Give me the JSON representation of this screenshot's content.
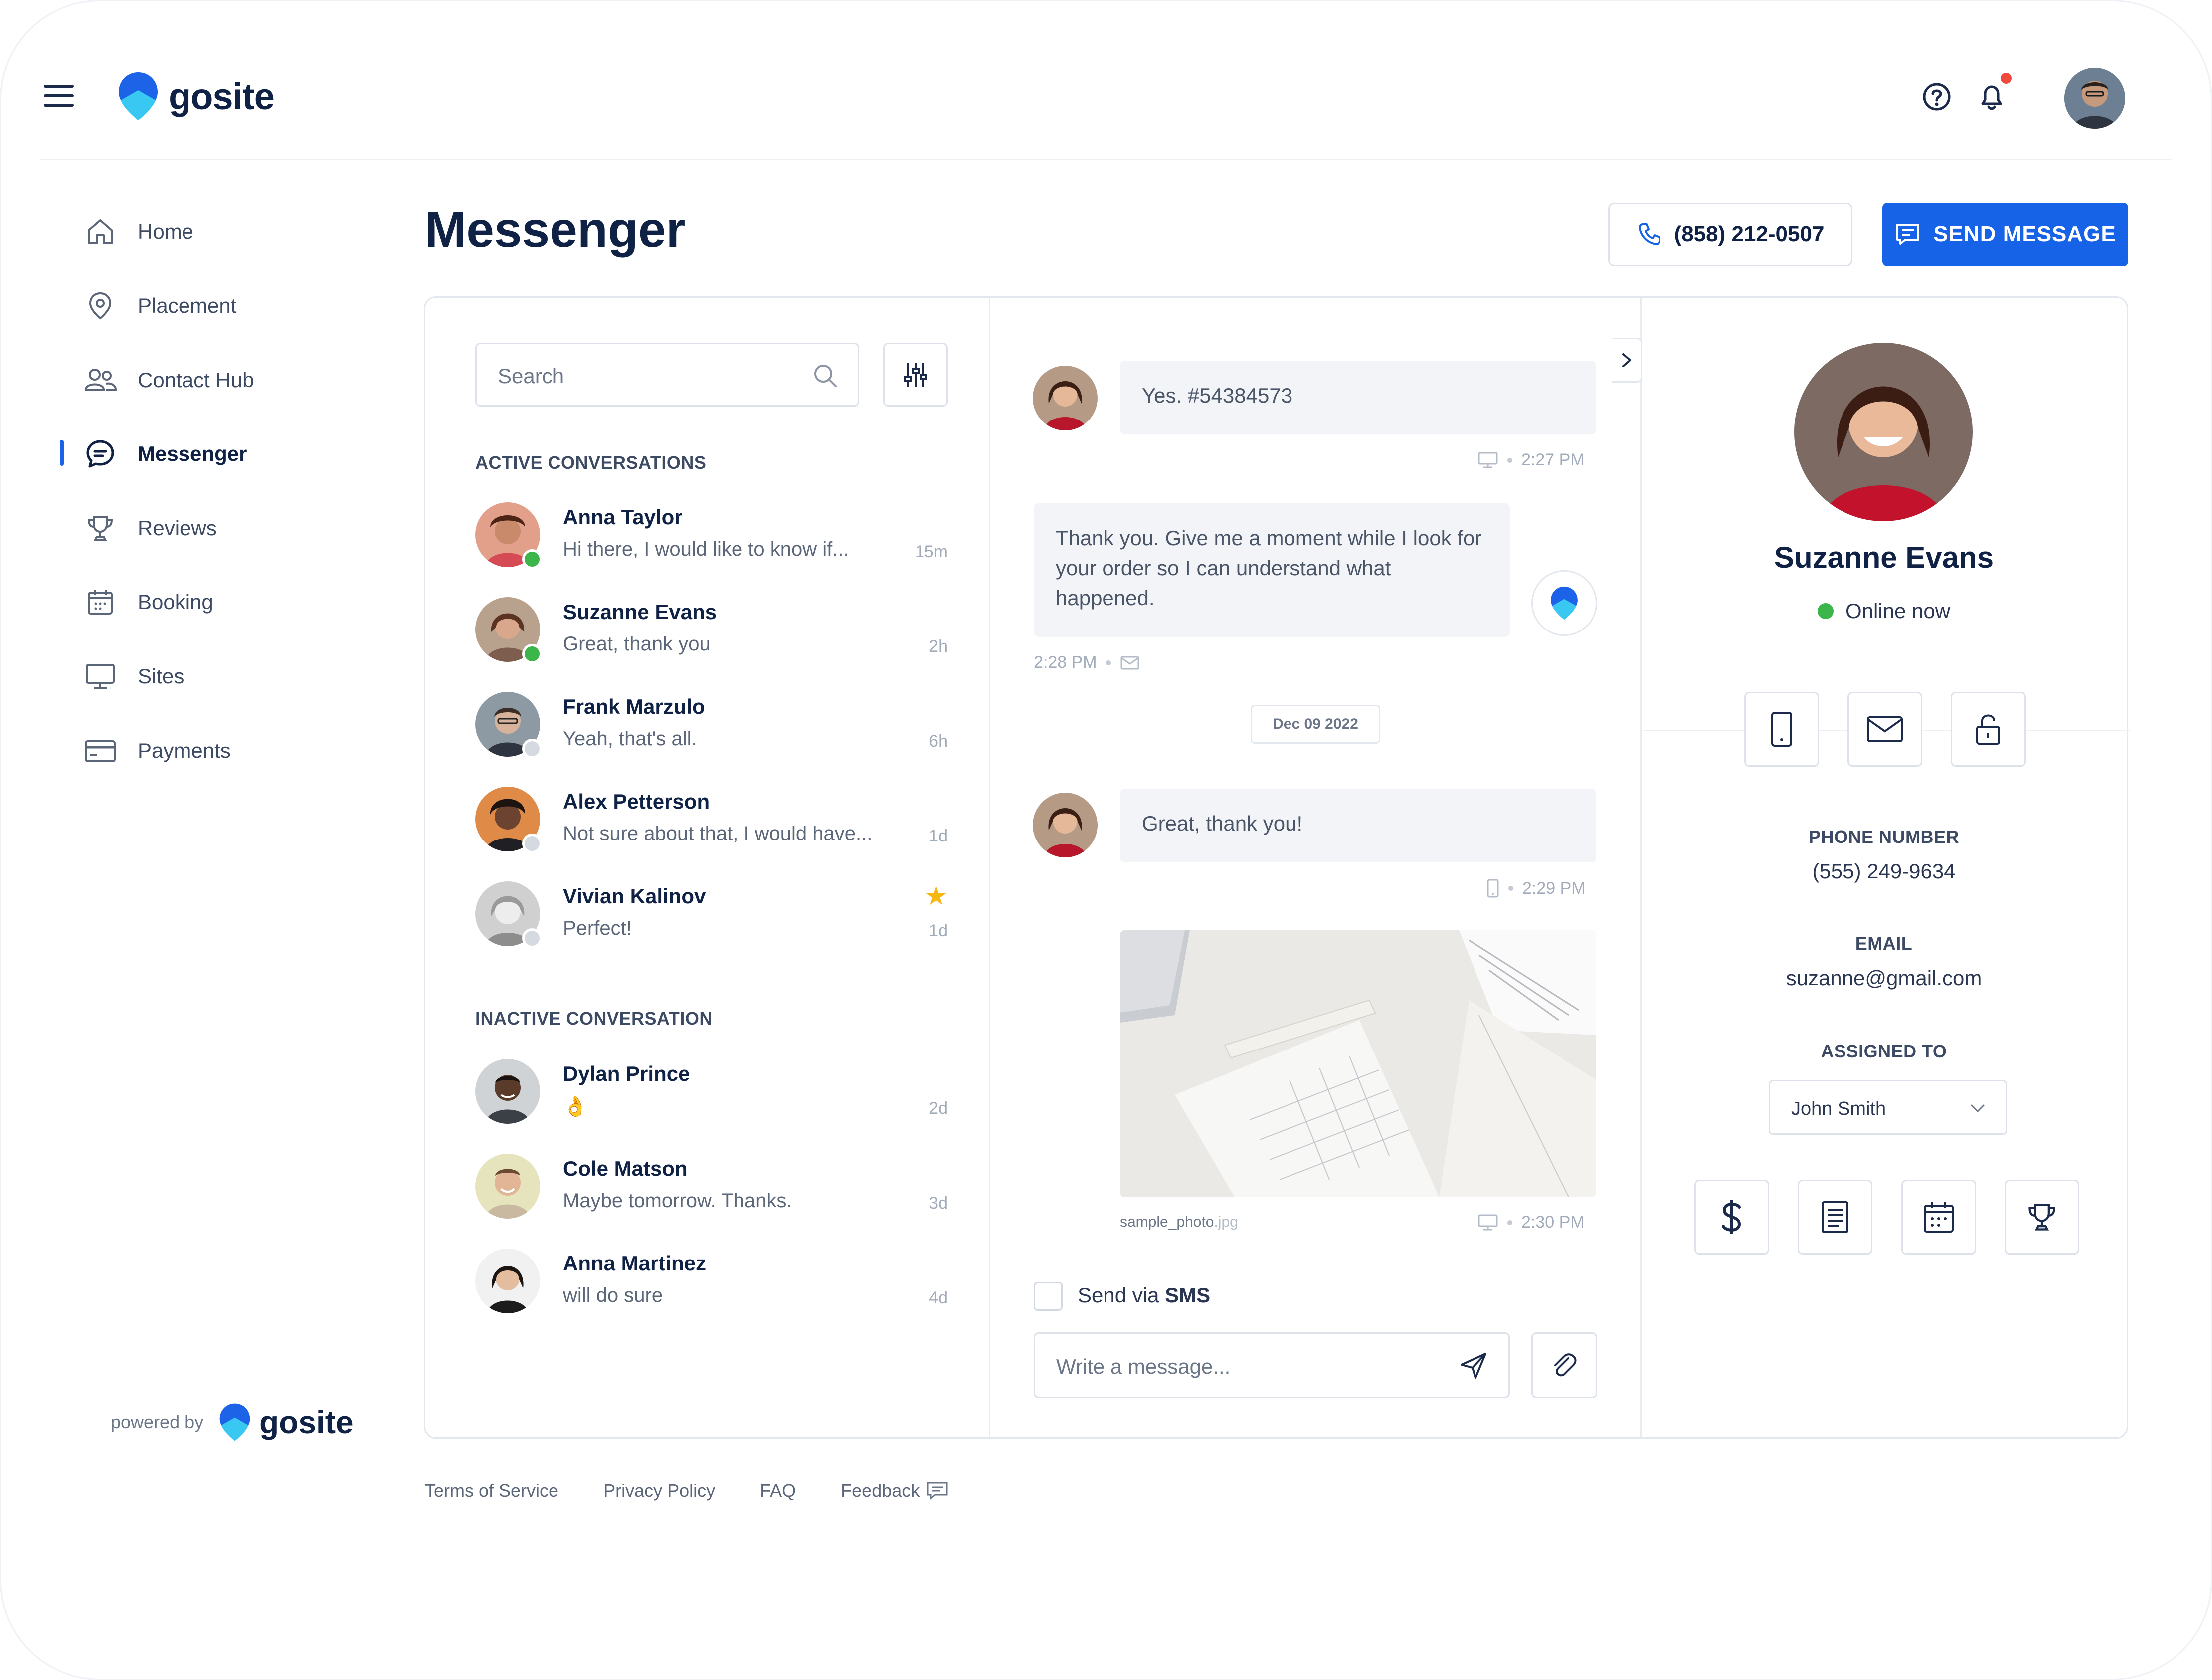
{
  "brand": {
    "name": "gosite",
    "powered_by": "powered by"
  },
  "header": {
    "icons": [
      "menu-icon",
      "help-icon",
      "bell-icon"
    ],
    "has_notification": true
  },
  "sidebar": {
    "items": [
      {
        "label": "Home",
        "icon": "home-icon"
      },
      {
        "label": "Placement",
        "icon": "location-pin-icon"
      },
      {
        "label": "Contact Hub",
        "icon": "contacts-icon"
      },
      {
        "label": "Messenger",
        "icon": "chat-icon",
        "active": true
      },
      {
        "label": "Reviews",
        "icon": "trophy-icon"
      },
      {
        "label": "Booking",
        "icon": "calendar-icon"
      },
      {
        "label": "Sites",
        "icon": "monitor-icon"
      },
      {
        "label": "Payments",
        "icon": "credit-card-icon"
      }
    ]
  },
  "page": {
    "title": "Messenger",
    "phone_button": "(858) 212-0507",
    "send_button": "SEND MESSAGE"
  },
  "conversations": {
    "search_placeholder": "Search",
    "active_label": "ACTIVE CONVERSATIONS",
    "inactive_label": "INACTIVE CONVERSATION",
    "active": [
      {
        "name": "Anna Taylor",
        "preview": "Hi there, I would like to know if...",
        "time": "15m",
        "online": true
      },
      {
        "name": "Suzanne Evans",
        "preview": "Great, thank you",
        "time": "2h",
        "online": true
      },
      {
        "name": "Frank Marzulo",
        "preview": "Yeah, that's all.",
        "time": "6h",
        "online": false
      },
      {
        "name": "Alex Petterson",
        "preview": "Not sure about that, I would have...",
        "time": "1d",
        "online": false
      },
      {
        "name": "Vivian Kalinov",
        "preview": "Perfect!",
        "time": "1d",
        "online": false,
        "starred": true
      }
    ],
    "inactive": [
      {
        "name": "Dylan Prince",
        "preview": "👌",
        "time": "2d"
      },
      {
        "name": "Cole Matson",
        "preview": "Maybe tomorrow. Thanks.",
        "time": "3d"
      },
      {
        "name": "Anna Martinez",
        "preview": "will do sure",
        "time": "4d"
      }
    ]
  },
  "chat": {
    "messages": [
      {
        "text": "Yes. #54384573",
        "time": "2:27 PM",
        "channel": "monitor-icon"
      },
      {
        "text": "Thank you. Give me a moment while I look for your order so I can understand what happened.",
        "time": "2:28 PM",
        "channel": "mail-icon"
      },
      {
        "text": "Great, thank you!",
        "time": "2:29 PM",
        "channel": "phone-icon"
      }
    ],
    "date_divider": "Dec 09 2022",
    "attachment": {
      "name": "sample_photo",
      "ext": ".jpg",
      "time": "2:30 PM",
      "channel": "monitor-icon"
    },
    "send_via_prefix": "Send via",
    "send_via_channel": "SMS",
    "input_placeholder": "Write a message..."
  },
  "profile": {
    "name": "Suzanne Evans",
    "status": "Online now",
    "phone_label": "PHONE NUMBER",
    "phone": "(555) 249-9634",
    "email_label": "EMAIL",
    "email": "suzanne@gmail.com",
    "assigned_label": "ASSIGNED TO",
    "assigned": "John Smith",
    "contact_actions": [
      "phone-icon",
      "mail-icon",
      "lock-icon"
    ],
    "quick_actions": [
      "dollar-icon",
      "document-icon",
      "calendar-icon",
      "trophy-icon"
    ]
  },
  "footer": {
    "links": [
      "Terms of Service",
      "Privacy Policy",
      "FAQ",
      "Feedback"
    ]
  },
  "colors": {
    "accent": "#1763e8",
    "navy": "#0f2245",
    "online": "#3cb54a",
    "notification": "#f0493e",
    "star": "#f5b812"
  }
}
